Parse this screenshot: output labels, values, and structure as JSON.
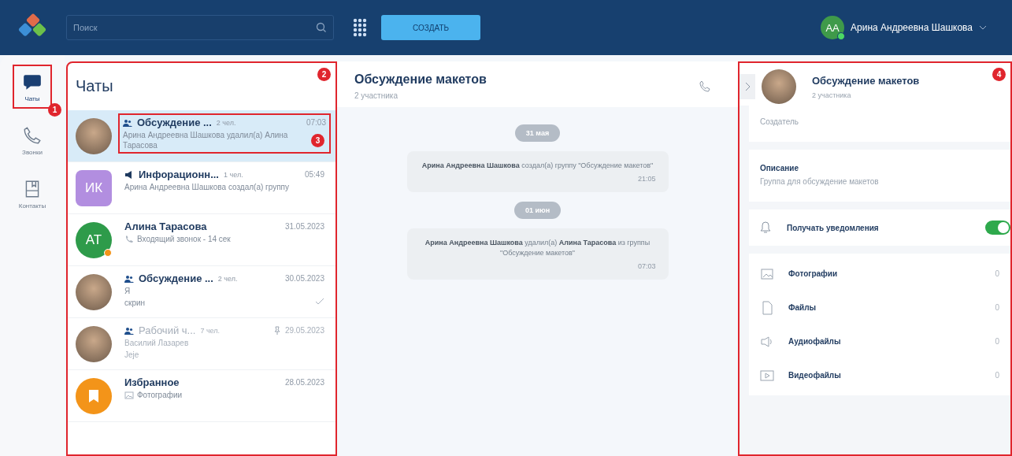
{
  "top_bar": {
    "search": {
      "placeholder": "Поиск"
    },
    "create_button": "СОЗДАТЬ",
    "user": {
      "initials": "АА",
      "name": "Арина Андреевна Шашкова",
      "online": true
    }
  },
  "nav": [
    {
      "label": "Чаты",
      "selected": true,
      "callout": "1"
    },
    {
      "label": "Звонки",
      "selected": false
    },
    {
      "label": "Контакты",
      "selected": false
    }
  ],
  "chat_list": {
    "title": "Чаты",
    "callout": "2",
    "chats": [
      {
        "kind": "group",
        "name": "Обсуждение ...",
        "members": "2 чел.",
        "time": "07:03",
        "lines": [
          {
            "kind": "text",
            "text": "Арина Андреевна Шашкова удалил(а) Алина Тарасова"
          }
        ],
        "selected": true,
        "muted": false,
        "callout": "3"
      },
      {
        "kind": "channel",
        "name": "Инфорационн...",
        "members": "1 чел.",
        "time": "05:49",
        "lines": [
          {
            "kind": "text",
            "text": "Арина Андреевна Шашкова создал(а) группу"
          }
        ],
        "initials": "ИК",
        "color": "#b28ee0",
        "selected": false,
        "muted": false
      },
      {
        "kind": "person",
        "name": "Алина Тарасова",
        "time": "31.05.2023",
        "lines": [
          {
            "kind": "call",
            "text": "Входящий звонок - 14 сек"
          }
        ],
        "initials": "АТ",
        "color": "#2e9b4a",
        "status_dot": true,
        "selected": false,
        "muted": false
      },
      {
        "kind": "group",
        "name": "Обсуждение ...",
        "members": "2 чел.",
        "time": "30.05.2023",
        "lines": [
          {
            "kind": "text",
            "text": "Я"
          },
          {
            "kind": "text",
            "text": "скрин"
          }
        ],
        "read_tick": true,
        "selected": false,
        "muted": false
      },
      {
        "kind": "group",
        "name": "Рабочий ч...",
        "members": "7 чел.",
        "time": "29.05.2023",
        "pinned": true,
        "lines": [
          {
            "kind": "text",
            "text": "Василий Лазарев"
          },
          {
            "kind": "text",
            "text": "Jeje"
          }
        ],
        "selected": false,
        "muted": true
      },
      {
        "kind": "favorites",
        "name": "Избранное",
        "time": "28.05.2023",
        "lines": [
          {
            "kind": "photo",
            "text": "Фотографии"
          }
        ],
        "color": "#f39419",
        "selected": false,
        "muted": false
      }
    ]
  },
  "conversation": {
    "title": "Обсуждение макетов",
    "subtitle": "2 участника",
    "messages": [
      {
        "date": "31 мая",
        "text": "**Арина Андреевна Шашкова** создал(а) группу \"Обсуждение макетов\"",
        "time": "21:05"
      },
      {
        "date": "01 июн",
        "text": "**Арина Андреевна Шашкова** удалил(а) **Алина Тарасова** из группы \"Обсуждение макетов\"",
        "time": "07:03"
      }
    ]
  },
  "info_panel": {
    "callout": "4",
    "title": "Обсуждение макетов",
    "subtitle": "2 участника",
    "creator_label": "Создатель",
    "description_label": "Описание",
    "description": "Группа для обсуждение макетов",
    "notifications": {
      "label": "Получать уведомления",
      "on": true
    },
    "media": [
      {
        "kind": "photo",
        "label": "Фотографии",
        "count": "0"
      },
      {
        "kind": "file",
        "label": "Файлы",
        "count": "0"
      },
      {
        "kind": "audio",
        "label": "Аудиофайлы",
        "count": "0"
      },
      {
        "kind": "video",
        "label": "Видеофайлы",
        "count": "0"
      }
    ]
  }
}
